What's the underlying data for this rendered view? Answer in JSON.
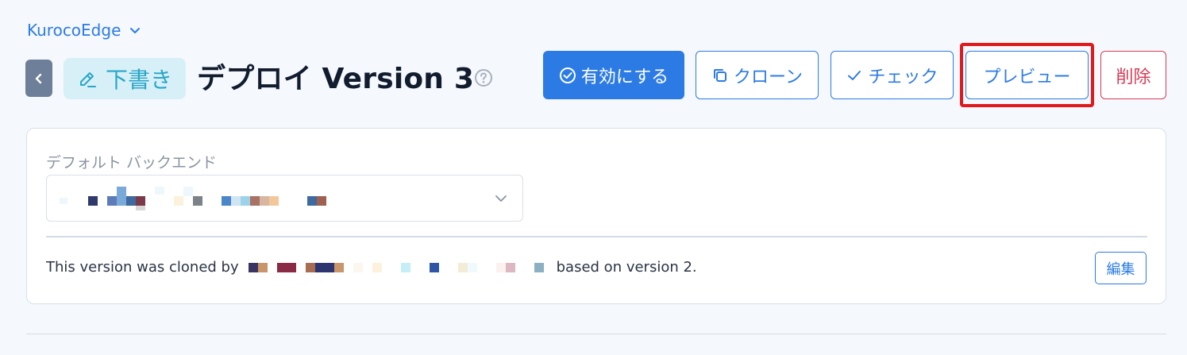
{
  "header": {
    "app_switcher_label": "KurocoEdge",
    "status_badge": "下書き",
    "title": "デプロイ Version 3"
  },
  "actions": {
    "activate": "有効にする",
    "clone": "クローン",
    "check": "チェック",
    "preview": "プレビュー",
    "delete": "削除"
  },
  "card": {
    "backend_label": "デフォルト バックエンド",
    "info_prefix": "This version was cloned by",
    "info_suffix": "based on version 2.",
    "edit_label": "編集"
  },
  "colors": {
    "primary": "#2c7be5",
    "danger": "#d63b55",
    "badge_bg": "#d7f0f8",
    "badge_text": "#2aa6c8",
    "highlight": "#e0191d"
  },
  "icons": {
    "app_switcher": "chevron-down-icon",
    "back": "chevron-left-icon",
    "badge": "pencil-icon",
    "help": "question-circle-icon",
    "activate": "check-circle-icon",
    "clone": "copy-icon",
    "check": "check-icon",
    "select": "chevron-down-icon"
  }
}
